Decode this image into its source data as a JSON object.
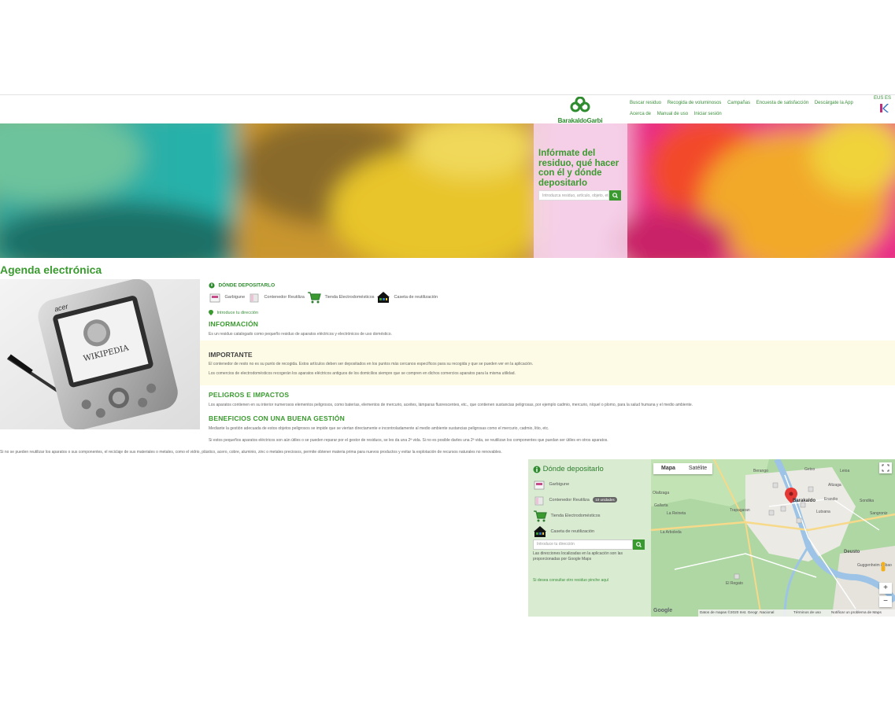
{
  "header": {
    "logo_text": "BarakaldoGarbi",
    "nav_row1": [
      "Buscar residuo",
      "Recogida de voluminosos",
      "Campañas",
      "Encuesta de satisfacción",
      "Descárgate la App"
    ],
    "nav_row2": [
      "Acerca de",
      "Manual de uso",
      "Iniciar sesión"
    ],
    "lang": "EUS ES",
    "colors": {
      "brand": "#3a9a2f"
    }
  },
  "hero": {
    "title": "Infórmate del residuo, qué hacer con él y dónde depositarlo",
    "search_placeholder": "Introduzca residuo, artículo, objeto, etc."
  },
  "page": {
    "title": "Agenda electrónica",
    "photo_brand": "acer",
    "photo_screen_text": "WIKIPEDIA"
  },
  "donde": {
    "heading": "DÓNDE DEPOSITARLO",
    "items": [
      "Garbigune",
      "Contenedor Reutiliza",
      "Tienda Electrodomésticos",
      "Caseta de reutilización"
    ],
    "address_link": "Introduce tu dirección"
  },
  "informacion": {
    "heading": "INFORMACIÓN",
    "text": "Es un residuo catalogado como pequeño residuo de aparatos eléctricos y electrónicos de uso doméstico."
  },
  "importante": {
    "heading": "IMPORTANTE",
    "lines": [
      "El contenedor de resto no es su punto de recogida. Estos artículos deben ser depositados en los puntos más cercanos específicos para su recogida y que se pueden ver en la aplicación.",
      "Los comercios de electrodomésticos recogerán los aparatos eléctricos antiguos de los domicilios siempre que se compren en dichos comercios aparatos para la misma utilidad."
    ]
  },
  "peligros": {
    "heading": "PELIGROS E IMPACTOS",
    "text": "Los aparatos contienen en su interior numerosos elementos peligrosos, como baterías, elementos de mercurio, aceites, lámparas fluorescentes, etc., que contienen sustancias peligrosas, por ejemplo cadmio, mercurio, níquel o plomo, para la salud humana y el medio ambiente."
  },
  "beneficios": {
    "heading": "BENEFICIOS CON UNA BUENA GESTIÓN",
    "lines": [
      "Mediante la gestión adecuada de estos objetos peligrosos se impide que se viertan directamente e incontroladamente al medio ambiente sustancias peligrosas como el mercurio, cadmio, litio, etc.",
      "Si estos pequeños aparatos eléctricos son aún útiles o se pueden reparar por el gestor de residuos, se les da una 2ª vida. Si no es posible darles una 2ª vida, se reutilizan los componentes que puedan ser útiles en otros aparatos.",
      "Si no se pueden reutilizar los aparatos o sus componentes, el reciclaje de sus materiales o metales, como el vidrio, plástico, acero, cobre, aluminio, zinc o metales preciosos, permite obtener materia prima para nuevos productos y evitar la explotación de recursos naturales no renovables."
    ]
  },
  "map_panel": {
    "title": "Dónde depositarlo",
    "items": [
      "Garbigune",
      "Contenedor Reutiliza",
      "Tienda Electrodomésticos",
      "Caseta de reutilización"
    ],
    "badge": "10 unidades",
    "address_placeholder": "Introduce tu dirección",
    "note": "Las direcciones localizadas en la aplicación son las proporcionadas por Google Maps",
    "link": "Si desea consultar otro residuo pinche aquí"
  },
  "map": {
    "tab_map": "Mapa",
    "tab_sat": "Satélite",
    "places": [
      "Berango",
      "Getxo",
      "Altzaga",
      "Leioa",
      "Barakaldo",
      "Erandio",
      "Sondika",
      "Lutxana",
      "Sangroniz",
      "La Arboleda",
      "La Reineta",
      "Trapagaran",
      "Deusto",
      "Guggenheim Bilbao",
      "El Regato",
      "Gallarta",
      "Olaltzaga"
    ],
    "attribution": "Datos de mapas ©2020 Inst. Geogr. Nacional",
    "terms": "Términos de uso",
    "report": "Notificar un problema de Maps",
    "google": "Google",
    "zoom_in": "+",
    "zoom_out": "−"
  }
}
